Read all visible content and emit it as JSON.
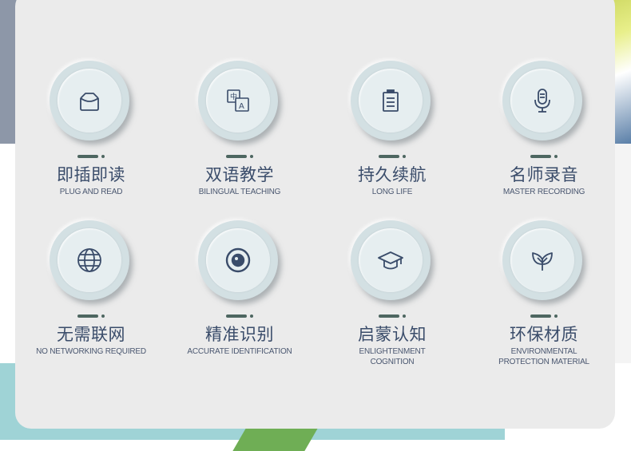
{
  "colors": {
    "card": "#ebebeb",
    "title": "#3a4c6a",
    "accent": "#4d6660",
    "circle": "#d3e0e3"
  },
  "features": [
    {
      "title": "即插即读",
      "subtitle": "PLUG AND READ",
      "icon": "plug-icon"
    },
    {
      "title": "双语教学",
      "subtitle": "BILINGUAL TEACHING",
      "icon": "translate-icon"
    },
    {
      "title": "持久续航",
      "subtitle": "LONG LIFE",
      "icon": "battery-icon"
    },
    {
      "title": "名师录音",
      "subtitle": "MASTER RECORDING",
      "icon": "microphone-icon"
    },
    {
      "title": "无需联网",
      "subtitle": "NO NETWORKING REQUIRED",
      "icon": "globe-icon"
    },
    {
      "title": "精准识别",
      "subtitle": "ACCURATE IDENTIFICATION",
      "icon": "target-icon"
    },
    {
      "title": "启蒙认知",
      "subtitle": "ENLIGHTENMENT COGNITION",
      "icon": "graduation-cap-icon"
    },
    {
      "title": "环保材质",
      "subtitle": "ENVIRONMENTAL PROTECTION MATERIAL",
      "icon": "sprout-icon"
    }
  ]
}
